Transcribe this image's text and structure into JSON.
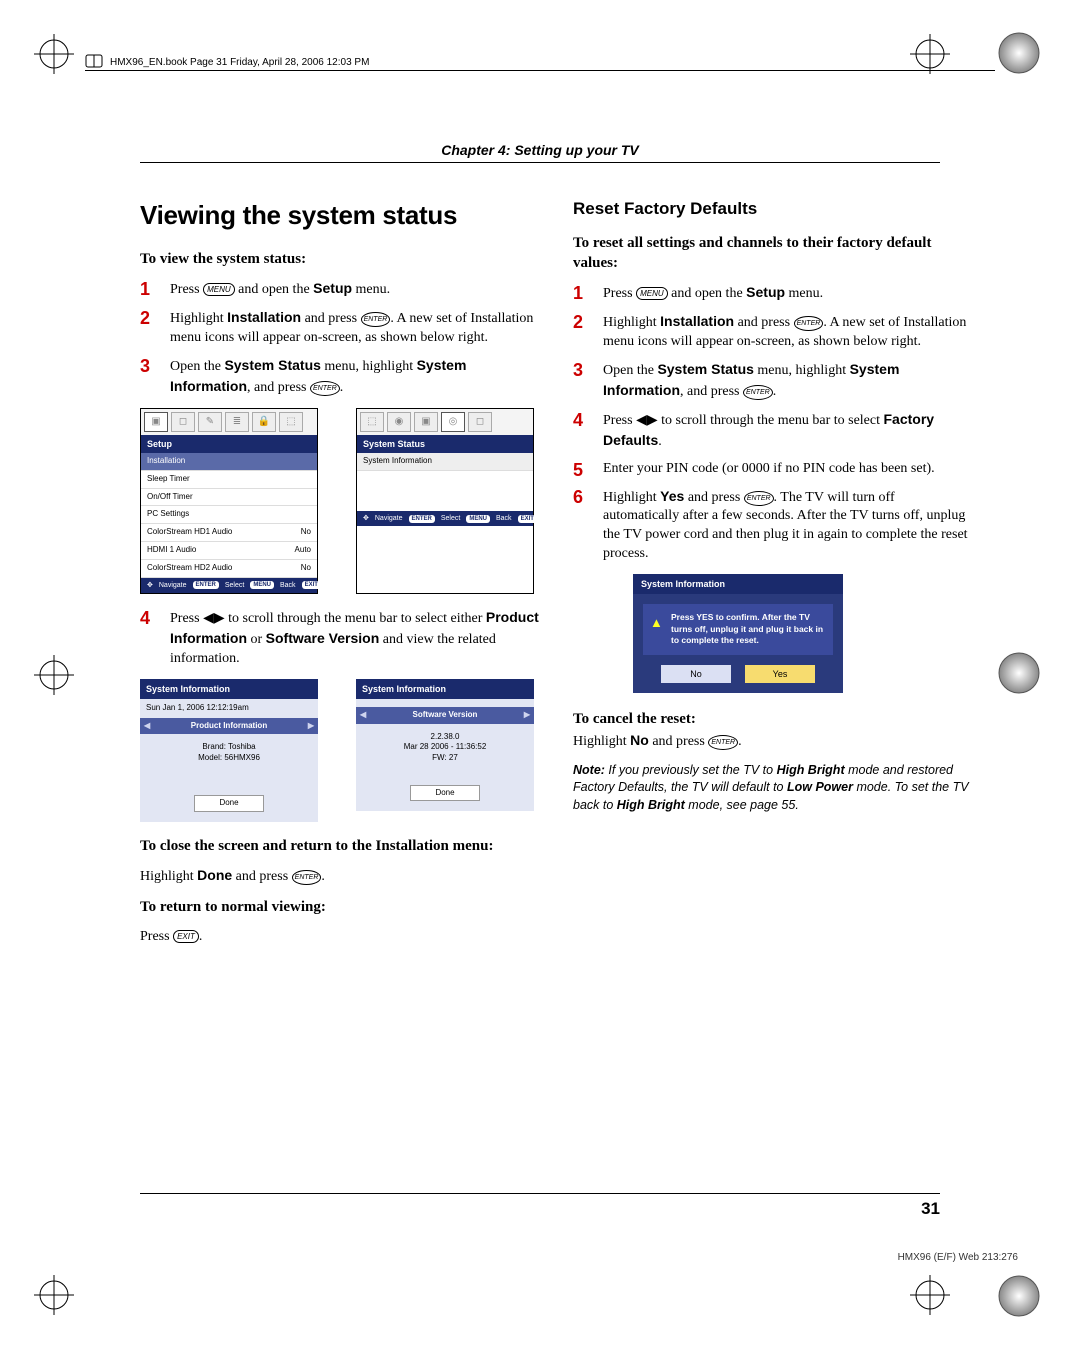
{
  "header_path": "HMX96_EN.book  Page 31  Friday, April 28, 2006  12:03 PM",
  "chapter": "Chapter 4: Setting up your TV",
  "left": {
    "h1": "Viewing the system status",
    "lead": "To view the system status:",
    "steps": [
      {
        "pre": "Press ",
        "key": "MENU",
        "post": " and open the ",
        "bold": "Setup",
        "post2": " menu."
      },
      {
        "pre": "Highlight ",
        "bold": "Installation",
        "mid": " and press ",
        "key": "ENTER",
        "post": ". A new set of Installation menu icons will appear on-screen, as shown below right."
      },
      {
        "pre": "Open the ",
        "bold": "System Status",
        "mid": " menu, highlight ",
        "bold2": "System Information",
        "mid2": ", and press ",
        "key": "ENTER",
        "post": "."
      }
    ],
    "menu1": {
      "title": "Setup",
      "items": [
        {
          "l": "Installation",
          "r": "",
          "hl": true
        },
        {
          "l": "Sleep Timer",
          "r": ""
        },
        {
          "l": "On/Off Timer",
          "r": ""
        },
        {
          "l": "PC Settings",
          "r": ""
        },
        {
          "l": "ColorStream HD1 Audio",
          "r": "No"
        },
        {
          "l": "HDMI 1 Audio",
          "r": "Auto"
        },
        {
          "l": "ColorStream HD2 Audio",
          "r": "No"
        }
      ],
      "footer": [
        "Navigate",
        "Select",
        "Back",
        "Exit"
      ],
      "footer_pills": [
        "ENTER",
        "MENU",
        "EXIT"
      ]
    },
    "menu2": {
      "title": "System Status",
      "items": [
        {
          "l": "System Information",
          "r": "",
          "hl": false
        }
      ],
      "footer": [
        "Navigate",
        "Select",
        "Back",
        "Exit"
      ],
      "footer_pills": [
        "ENTER",
        "MENU",
        "EXIT"
      ]
    },
    "step4": {
      "pre": "Press ",
      "arrows": "◀▶",
      "mid": " to scroll through the menu bar to select either ",
      "bold": "Product Information",
      "mid2": " or ",
      "bold2": "Software Version",
      "post": " and view the related information."
    },
    "info1": {
      "title": "System Information",
      "sub": "Sun Jan 1, 2006  12:12:19am",
      "bar": "Product Information",
      "lines": [
        "Brand:  Toshiba",
        "Model:  56HMX96"
      ],
      "done": "Done"
    },
    "info2": {
      "title": "System Information",
      "bar": "Software Version",
      "lines": [
        "2.2.38.0",
        "Mar 28 2006 - 11:36:52",
        "FW: 27"
      ],
      "done": "Done"
    },
    "close_lead": "To close the screen and return to the Installation menu:",
    "close_body_a": "Highlight ",
    "close_body_bold": "Done",
    "close_body_b": " and press ",
    "close_key": "ENTER",
    "close_body_c": ".",
    "return_lead": "To return to normal viewing:",
    "return_body_a": "Press ",
    "return_key": "EXIT",
    "return_body_b": "."
  },
  "right": {
    "h2": "Reset Factory Defaults",
    "lead": "To reset all settings and channels to their factory default values:",
    "steps": [
      {
        "pre": "Press ",
        "key": "MENU",
        "post": " and open the ",
        "bold": "Setup",
        "post2": " menu."
      },
      {
        "pre": "Highlight ",
        "bold": "Installation",
        "mid": " and press ",
        "key": "ENTER",
        "post": ". A new set of Installation menu icons will appear on-screen, as shown below right."
      },
      {
        "pre": "Open the ",
        "bold": "System Status",
        "mid": " menu, highlight ",
        "bold2": "System Information",
        "mid2": ", and press ",
        "key": "ENTER",
        "post": "."
      },
      {
        "pre": "Press ",
        "arrows": "◀▶",
        "post": " to scroll through the menu bar to select ",
        "bold": "Factory Defaults",
        "post2": "."
      },
      {
        "pre": "Enter your PIN code (or 0000 if no PIN code has been set)."
      },
      {
        "pre": "Highlight ",
        "bold": "Yes",
        "mid": " and press ",
        "key": "ENTER",
        "post": ". The TV will turn off automatically after a few seconds. After the TV turns off, unplug the TV power cord and then plug it in again to complete the reset process."
      }
    ],
    "dialog": {
      "title": "System Information",
      "msg": "Press YES to confirm. After the TV turns off, unplug it and plug it back in to complete the reset.",
      "no": "No",
      "yes": "Yes"
    },
    "cancel_lead": "To cancel the reset:",
    "cancel_body_a": "Highlight ",
    "cancel_bold": "No",
    "cancel_body_b": " and press ",
    "cancel_key": "ENTER",
    "cancel_body_c": ".",
    "note_label": "Note:",
    "note_a": " If you previously set the TV to ",
    "note_b1": "High Bright",
    "note_b": " mode and restored Factory Defaults, the TV will default to ",
    "note_b2": "Low Power",
    "note_c": " mode. To set the TV back to ",
    "note_b3": "High Bright",
    "note_d": " mode, see page 55."
  },
  "page_number": "31",
  "footer_code": "HMX96 (E/F) Web 213:276"
}
